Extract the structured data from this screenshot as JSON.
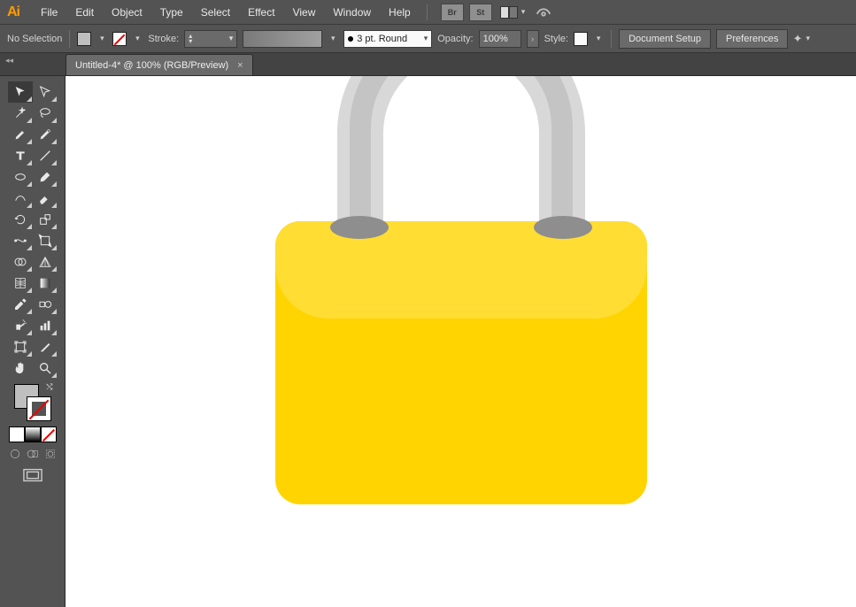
{
  "app": {
    "logo": "Ai"
  },
  "menu": [
    "File",
    "Edit",
    "Object",
    "Type",
    "Select",
    "Effect",
    "View",
    "Window",
    "Help"
  ],
  "menubar_buttons": {
    "bridge": "Br",
    "stock": "St"
  },
  "control": {
    "selection_status": "No Selection",
    "stroke_label": "Stroke:",
    "stroke_style": "3 pt. Round",
    "opacity_label": "Opacity:",
    "opacity_value": "100%",
    "style_label": "Style:",
    "doc_setup": "Document Setup",
    "preferences": "Preferences"
  },
  "tab": {
    "title": "Untitled-4* @ 100% (RGB/Preview)"
  },
  "colors": {
    "lock_body": "#ffd400",
    "lock_highlight": "#ffdd33",
    "shackle": "#d8d8d8",
    "shackle_shadow": "#c4c4c4",
    "shackle_hole": "#8e8e8e"
  }
}
